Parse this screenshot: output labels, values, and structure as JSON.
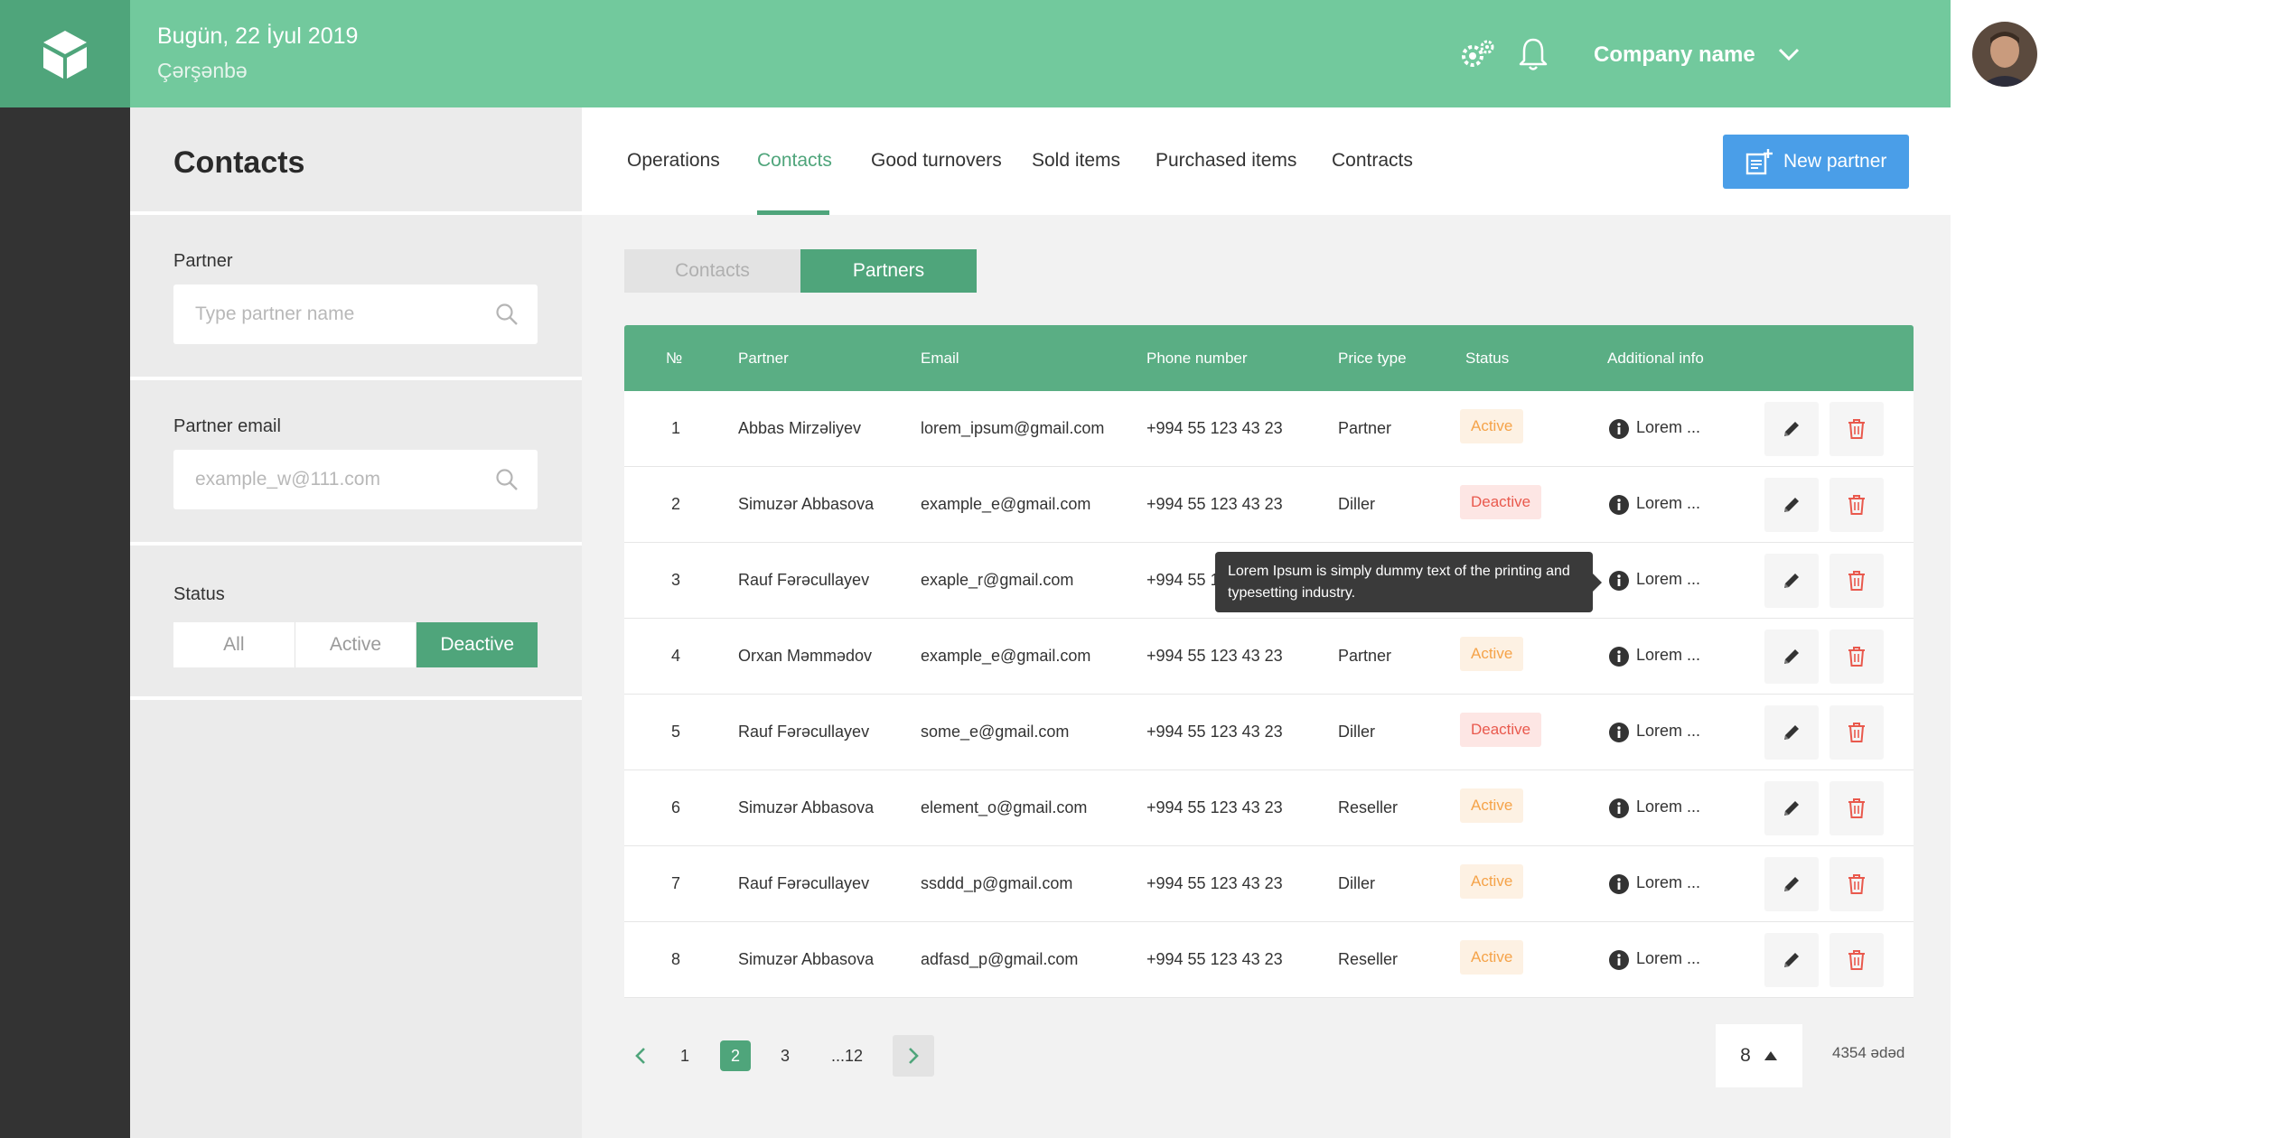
{
  "header": {
    "date": "Bugün, 22 İyul 2019",
    "weekday": "Çərşənbə",
    "company_name": "Company name",
    "icons": [
      "gear-icon",
      "bell-icon",
      "chevron-down-icon"
    ]
  },
  "filters": {
    "title": "Contacts",
    "partner": {
      "label": "Partner",
      "placeholder": "Type partner name"
    },
    "partner_email": {
      "label": "Partner email",
      "placeholder": "example_w@111.com"
    },
    "status": {
      "label": "Status",
      "options": [
        "All",
        "Active",
        "Deactive"
      ],
      "selected": "Deactive"
    }
  },
  "nav": {
    "tabs": [
      "Operations",
      "Contacts",
      "Good turnovers",
      "Sold items",
      "Purchased items",
      "Contracts"
    ],
    "active_tab": "Contacts",
    "new_partner_label": "New partner"
  },
  "subtabs": {
    "items": [
      "Contacts",
      "Partners"
    ],
    "active": "Partners"
  },
  "table": {
    "columns": [
      "№",
      "Partner",
      "Email",
      "Phone number",
      "Price type",
      "Status",
      "Additional info"
    ],
    "rows": [
      {
        "no": "1",
        "partner": "Abbas Mirzəliyev",
        "email": "lorem_ipsum@gmail.com",
        "phone": "+994 55 123 43 23",
        "price_type": "Partner",
        "status": "Active",
        "info": "Lorem ..."
      },
      {
        "no": "2",
        "partner": "Simuzər Abbasova",
        "email": "example_e@gmail.com",
        "phone": "+994 55 123 43 23",
        "price_type": "Diller",
        "status": "Deactive",
        "info": "Lorem ..."
      },
      {
        "no": "3",
        "partner": "Rauf Fərəcullayev",
        "email": "exaple_r@gmail.com",
        "phone": "+994 55 1",
        "price_type": "",
        "status": "",
        "info": "Lorem ..."
      },
      {
        "no": "4",
        "partner": "Orxan Məmmədov",
        "email": "example_e@gmail.com",
        "phone": "+994 55 123 43 23",
        "price_type": "Partner",
        "status": "Active",
        "info": "Lorem ..."
      },
      {
        "no": "5",
        "partner": "Rauf Fərəcullayev",
        "email": "some_e@gmail.com",
        "phone": "+994 55 123 43 23",
        "price_type": "Diller",
        "status": "Deactive",
        "info": "Lorem ..."
      },
      {
        "no": "6",
        "partner": "Simuzər Abbasova",
        "email": "element_o@gmail.com",
        "phone": "+994 55 123 43 23",
        "price_type": "Reseller",
        "status": "Active",
        "info": "Lorem ..."
      },
      {
        "no": "7",
        "partner": "Rauf Fərəcullayev",
        "email": "ssddd_p@gmail.com",
        "phone": "+994 55 123 43 23",
        "price_type": "Diller",
        "status": "Active",
        "info": "Lorem ..."
      },
      {
        "no": "8",
        "partner": "Simuzər Abbasova",
        "email": "adfasd_p@gmail.com",
        "phone": "+994 55 123 43 23",
        "price_type": "Reseller",
        "status": "Active",
        "info": "Lorem ..."
      }
    ]
  },
  "tooltip": {
    "text": "Lorem Ipsum is simply dummy text of the printing and typesetting industry."
  },
  "pagination": {
    "pages": [
      "1",
      "2",
      "3",
      "...12"
    ],
    "current": "2",
    "per_page": "8",
    "total": "4354 ədəd"
  },
  "colors": {
    "header_green": "#72c99d",
    "accent_green": "#4fa57b",
    "table_header": "#5aae84",
    "button_blue": "#4a9ee8",
    "status_active": "#f5a349",
    "status_deactive": "#e9594d",
    "sidebar_dark": "#333333"
  }
}
